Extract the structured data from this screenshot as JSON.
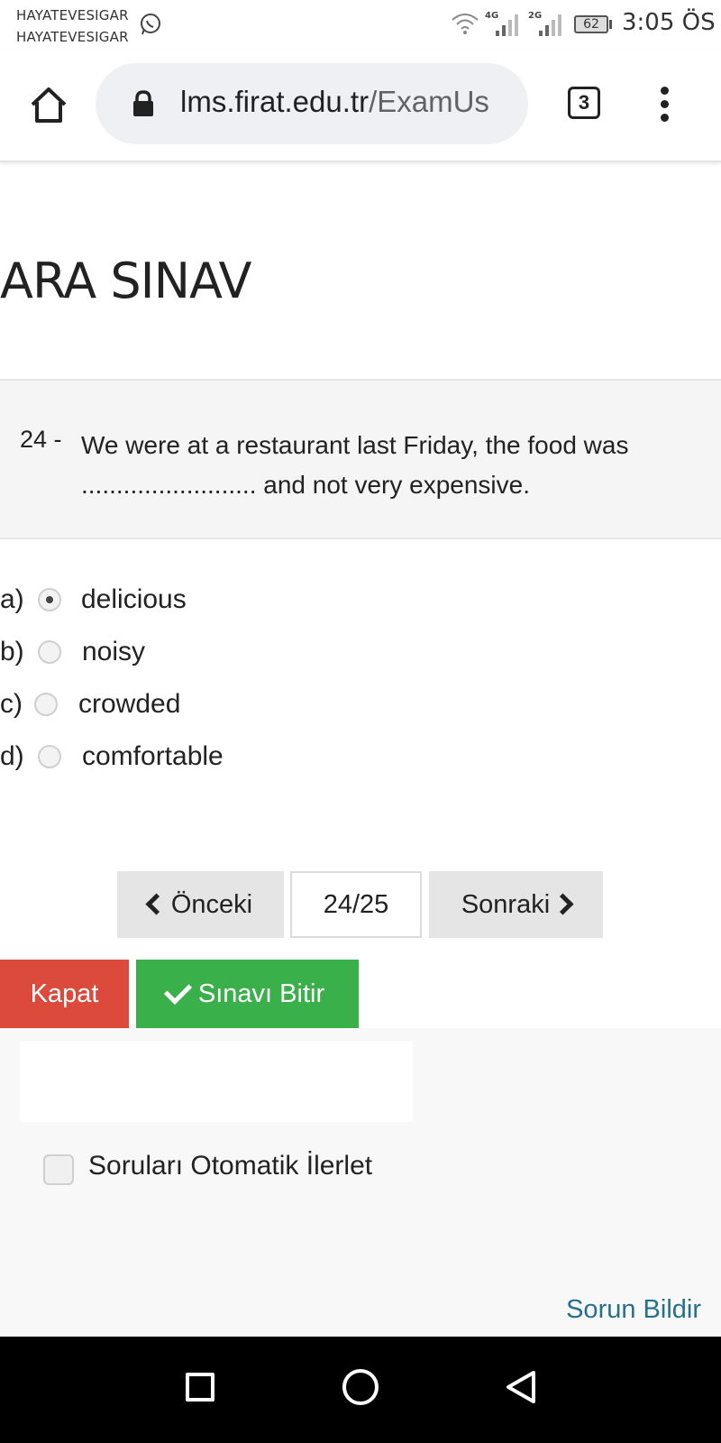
{
  "status_bar": {
    "carrier_1": "HAYATEVESIGAR",
    "carrier_2": "HAYATEVESIGAR",
    "net_1": "4G",
    "net_2": "2G",
    "battery": "62",
    "time": "3:05 ÖS"
  },
  "browser": {
    "url_host": "lms.firat.edu.tr",
    "url_path": "/ExamUs",
    "tab_count": "3"
  },
  "exam": {
    "title": "ARA SINAV",
    "question_number": "24 -",
    "question_text": "We were at a restaurant last Friday, the food was ......................... and not very expensive.",
    "options": [
      {
        "letter": "a)",
        "label": "delicious",
        "selected": true
      },
      {
        "letter": "b)",
        "label": "noisy",
        "selected": false
      },
      {
        "letter": "c)",
        "label": "crowded",
        "selected": false
      },
      {
        "letter": "d)",
        "label": "comfortable",
        "selected": false
      }
    ]
  },
  "pager": {
    "prev_label": "Önceki",
    "indicator": "24/25",
    "next_label": "Sonraki"
  },
  "actions": {
    "close_label": "Kapat",
    "finish_label": "Sınavı Bitir"
  },
  "footer": {
    "auto_advance_label": "Soruları Otomatik İlerlet",
    "report_link": "Sorun Bildir"
  },
  "colors": {
    "close_red": "#db4a3b",
    "finish_green": "#3ab04a",
    "link_teal": "#26708a"
  }
}
